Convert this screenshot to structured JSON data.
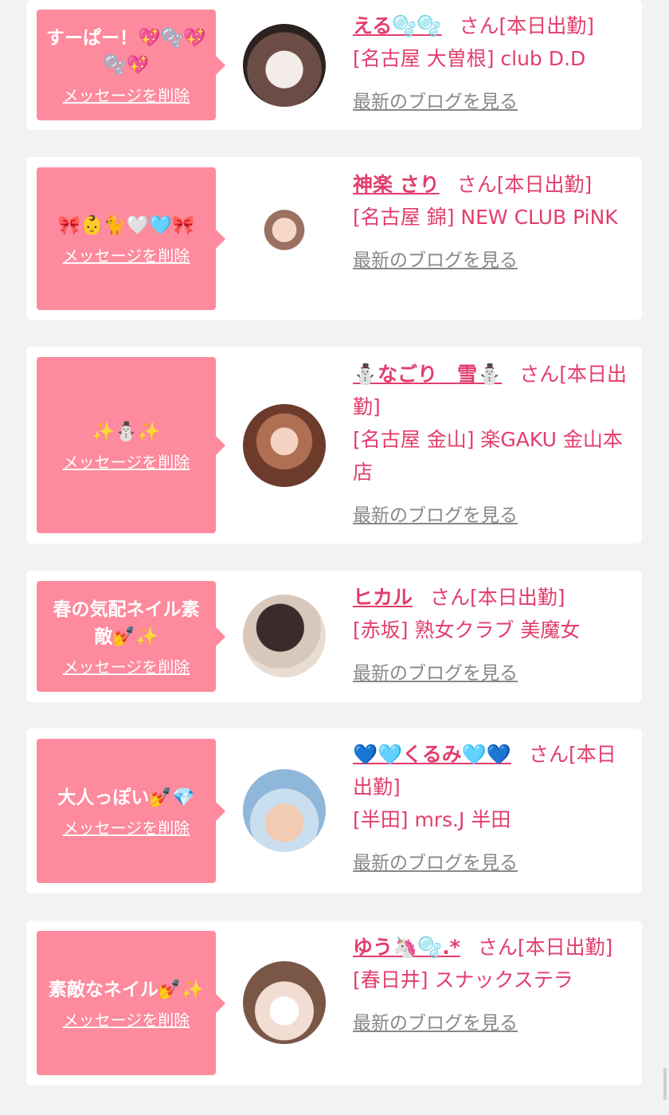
{
  "delete_label": "メッセージを削除",
  "blog_label": "最新のブログを見る",
  "san_suffix": "さん[本日出勤]",
  "colors": {
    "bubble": "#fd8a9d",
    "accent": "#e23e6d",
    "blog_link": "#888888"
  },
  "cards": [
    {
      "message": "すーぱー！💖🫧💖🫧💖",
      "name": "える🫧🫧",
      "shop": "[名古屋 大曽根] club D.D"
    },
    {
      "message": "🎀👶🐈🤍🩵🎀",
      "name": "神楽 さり",
      "shop": "[名古屋 錦] NEW CLUB PiNK"
    },
    {
      "message": "✨⛄✨",
      "name": "⛄なごり　雪⛄",
      "shop": "[名古屋 金山] 楽GAKU 金山本店"
    },
    {
      "message": "春の気配ネイル素敵💅✨",
      "name": "ヒカル",
      "shop": "[赤坂] 熟女クラブ 美魔女"
    },
    {
      "message": "大人っぽい💅💎",
      "name": "💙🩵くるみ🩵💙",
      "shop": "[半田] mrs.J 半田"
    },
    {
      "message": "素敵なネイル💅✨",
      "name": "ゆう🦄🫧.*",
      "shop": "[春日井] スナックステラ"
    }
  ]
}
